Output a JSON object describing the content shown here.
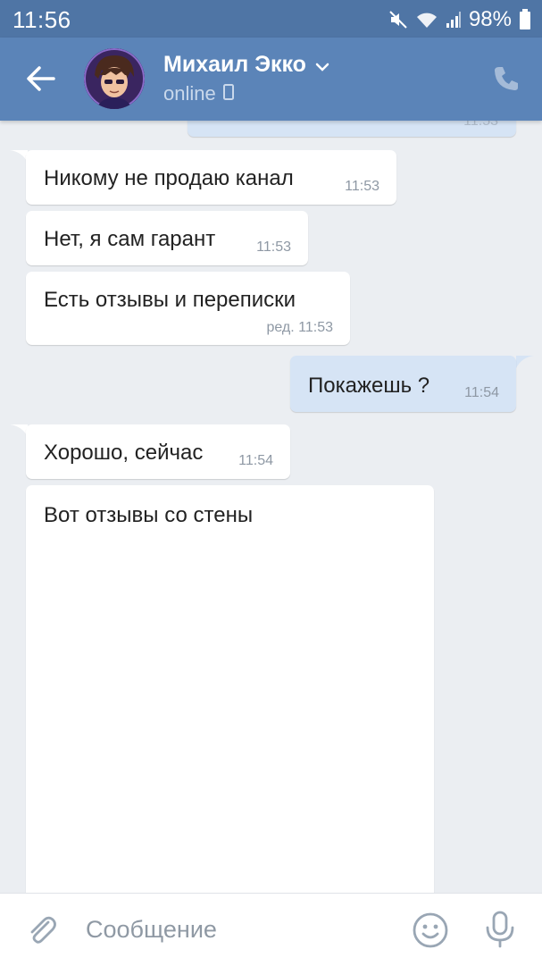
{
  "status_bar": {
    "time": "11:56",
    "battery": "98%"
  },
  "header": {
    "name": "Михаил Экко",
    "status": "online",
    "icons": [
      "back-arrow-icon",
      "chevron-down-icon",
      "mobile-phone-icon",
      "phone-call-icon"
    ]
  },
  "messages": [
    {
      "direction": "out",
      "text": "",
      "time": "11:53",
      "partial": true
    },
    {
      "direction": "in",
      "text": "Никому не продаю канал",
      "time": "11:53"
    },
    {
      "direction": "in",
      "text": "Нет, я сам гарант",
      "time": "11:53"
    },
    {
      "direction": "in",
      "text": "Есть отзывы и переписки",
      "time": "ред. 11:53"
    },
    {
      "direction": "out",
      "text": "Покажешь ?",
      "time": "11:54"
    },
    {
      "direction": "in",
      "text": "Хорошо, сейчас",
      "time": "11:54"
    },
    {
      "direction": "in",
      "text": "Вот отзывы со стены",
      "time": ""
    }
  ],
  "composer": {
    "placeholder": "Сообщение",
    "icons": [
      "paperclip-icon",
      "emoji-icon",
      "microphone-icon"
    ]
  },
  "colors": {
    "status_bar": "#4f75a5",
    "header": "#5b84b8",
    "background": "#ebeef2",
    "incoming_bubble": "#ffffff",
    "outgoing_bubble": "#d6e4f5"
  }
}
